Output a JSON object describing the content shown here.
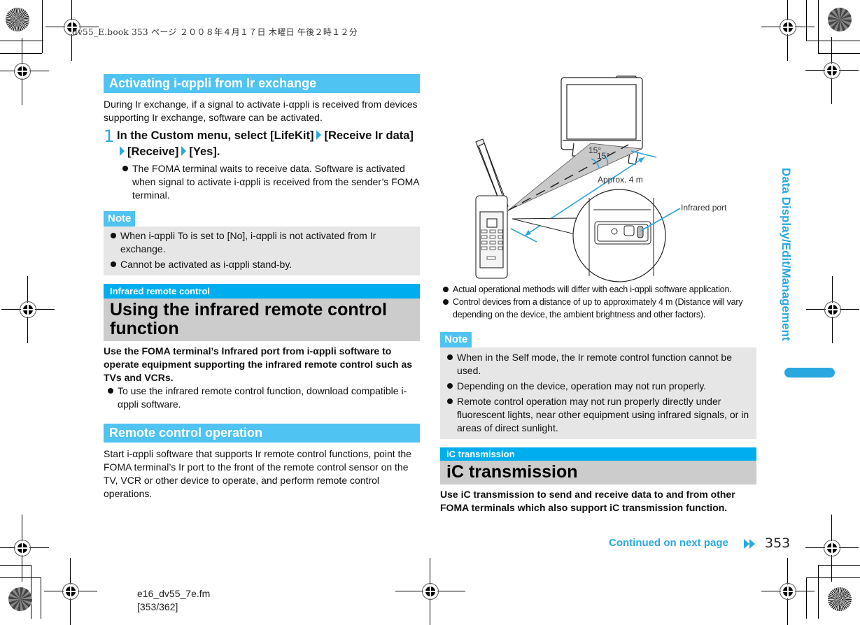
{
  "print_header": "dv55_E.book   353 ページ   ２００８年４月１７日   木曜日   午後２時１２分",
  "left_column": {
    "section1": {
      "heading": "Activating i-αppli from Ir exchange",
      "intro": "During Ir exchange, if a signal to activate i-αppli is received from devices supporting Ir exchange, software can be activated.",
      "step": {
        "number": "1",
        "parts": [
          "In the Custom menu, select [LifeKit]",
          "[Receive Ir data]",
          "[Receive]",
          "[Yes]."
        ],
        "bullet": "The FOMA terminal waits to receive data. Software is activated when signal to activate i-αppli is received from the sender’s FOMA terminal."
      }
    },
    "note1": {
      "label": "Note",
      "items": [
        "When i-αppli To is set to [No], i-αppli is not activated from Ir exchange.",
        "Cannot be activated as i-αppli stand-by."
      ]
    },
    "section2": {
      "category": "Infrared remote control",
      "title": "Using the infrared remote control function",
      "lead": "Use the FOMA terminal’s Infrared port from i-αppli software to operate equipment supporting the infrared remote control such as TVs and VCRs.",
      "bullet": "To use the infrared remote control function, download compatible i-αppli software."
    },
    "section3": {
      "heading": "Remote control operation",
      "body": "Start i-αppli software that supports Ir remote control functions, point the FOMA terminal’s Ir port to the front of the remote control sensor on the TV, VCR or other device to operate, and perform remote control operations."
    }
  },
  "right_column": {
    "illustration": {
      "angle_label_1": "15°",
      "angle_label_2": "15°",
      "distance_label": "Approx. 4 m",
      "port_label": "Infrared port"
    },
    "bullets": [
      "Actual operational methods will differ with each i-αppli software application.",
      "Control devices from a distance of up to approximately 4 m (Distance will vary depending on the device, the ambient brightness and other factors)."
    ],
    "note2": {
      "label": "Note",
      "items": [
        "When in the Self mode, the Ir remote control function cannot be used.",
        "Depending on the device, operation may not run properly.",
        "Remote control operation may not run properly directly under fluorescent lights, near other equipment using infrared signals, or in areas of direct sunlight."
      ]
    },
    "section4": {
      "category": "iC transmission",
      "title": "iC transmission",
      "lead": "Use iC transmission to send and receive data to and from other FOMA terminals which also support iC transmission function."
    }
  },
  "side_tab": "Data Display/Edit/Management",
  "footer": {
    "continued": "Continued on next page",
    "page_number": "353",
    "file_name": "e16_dv55_7e.fm",
    "page_range": "[353/362]"
  },
  "colors": {
    "accent_blue": "#29a8e0",
    "heading_blue": "#4fc3f1",
    "category_blue": "#00aeef",
    "note_gray": "#e6e6e6",
    "title_gray": "#cccccc"
  }
}
